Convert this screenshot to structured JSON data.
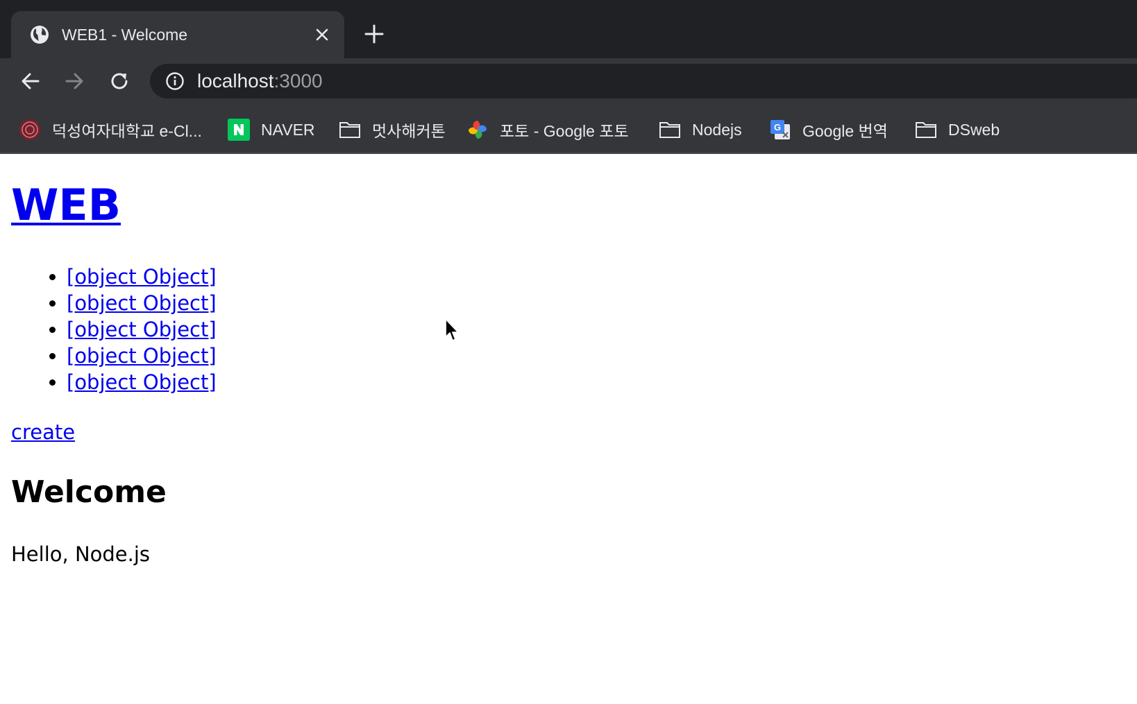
{
  "browser": {
    "tab": {
      "title": "WEB1 - Welcome",
      "favicon": "globe-icon"
    },
    "address_bar": {
      "host": "localhost",
      "port": ":3000"
    },
    "bookmarks": [
      {
        "label": "덕성여자대학교 e-Cl...",
        "icon": "university-seal-icon"
      },
      {
        "label": "NAVER",
        "icon": "naver-icon"
      },
      {
        "label": "멋사해커톤",
        "icon": "folder-icon"
      },
      {
        "label": "포토 - Google 포토",
        "icon": "google-photos-icon"
      },
      {
        "label": "Nodejs",
        "icon": "folder-icon"
      },
      {
        "label": "Google 번역",
        "icon": "google-translate-icon"
      },
      {
        "label": "DSweb",
        "icon": "folder-icon"
      }
    ]
  },
  "page": {
    "title": "WEB",
    "topics": [
      {
        "label": "[object Object]"
      },
      {
        "label": "[object Object]"
      },
      {
        "label": "[object Object]"
      },
      {
        "label": "[object Object]"
      },
      {
        "label": "[object Object]"
      }
    ],
    "create_label": "create",
    "content_title": "Welcome",
    "content_body": "Hello, Node.js"
  },
  "colors": {
    "chrome_dark": "#202124",
    "chrome_toolbar": "#35363a",
    "link": "#0000ee",
    "naver_green": "#03c75a"
  }
}
